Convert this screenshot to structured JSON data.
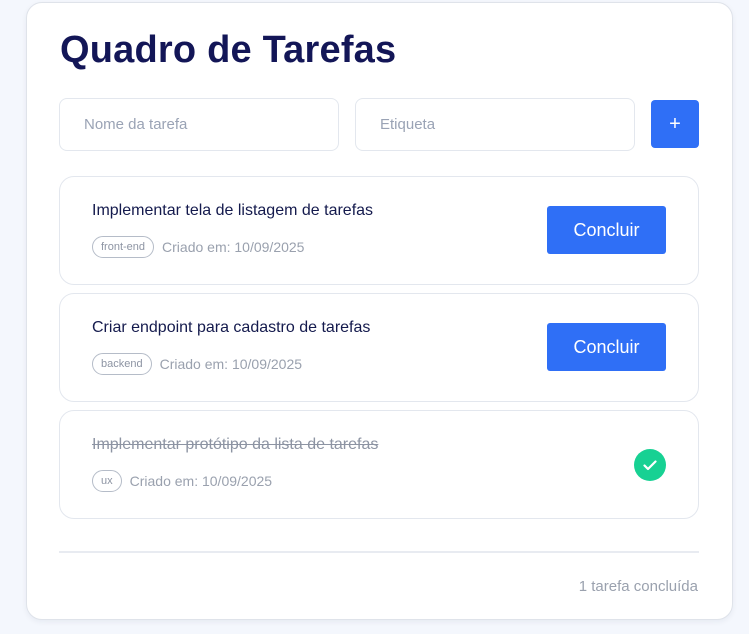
{
  "app": {
    "title": "Quadro de Tarefas"
  },
  "form": {
    "name_placeholder": "Nome da tarefa",
    "name_value": "",
    "tag_placeholder": "Etiqueta",
    "tag_value": "",
    "add_label": "+"
  },
  "tasks": [
    {
      "title": "Implementar tela de listagem de tarefas",
      "tag": "front-end",
      "created": "Criado em: 10/09/2025",
      "completed": false,
      "action_label": "Concluir"
    },
    {
      "title": "Criar endpoint para cadastro de tarefas",
      "tag": "backend",
      "created": "Criado em: 10/09/2025",
      "completed": false,
      "action_label": "Concluir"
    },
    {
      "title": "Implementar protótipo da lista de tarefas",
      "tag": "ux",
      "created": "Criado em: 10/09/2025",
      "completed": true,
      "status_icon": "check-circle-icon"
    }
  ],
  "footer": {
    "summary": "1 tarefa concluída"
  },
  "colors": {
    "primary": "#2f6ff6",
    "title": "#131657",
    "success": "#17d193"
  }
}
